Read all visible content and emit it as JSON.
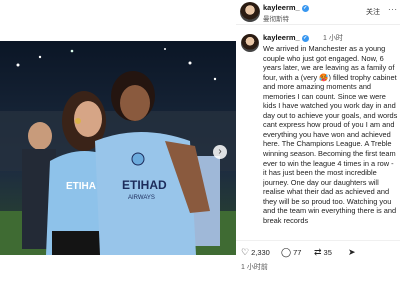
{
  "header": {
    "username": "kayleerm_",
    "subtitle": "曼彻斯特",
    "follow_label": "关注",
    "more_label": "···",
    "verified_icon": "verified-badge-icon"
  },
  "post": {
    "username": "kayleerm_",
    "time_ago": "1 小时",
    "caption": "We arrived in Manchester as a young couple who just got engaged. Now, 6 years later, we are leaving as a family of four, with a (very 🥵) filled trophy cabinet and more amazing moments and memories I can count. Since we were kids I have watched you work day in and day out to achieve your goals, and words cant express how proud of you I am and everything you have won and achieved here. The Champions League. A Treble winning season. Becoming the first team ever to win the league 4 times in a row - it has just been the most incredible journey. One day our daughters will realise what their dad as achieved and they will be so proud too. Watching you and the team win everything there is and break records"
  },
  "actions": {
    "likes": "2,330",
    "comments": "77",
    "reposts": "35"
  },
  "footer": {
    "time": "1 小时前"
  },
  "photo": {
    "jersey_sponsor": "ETIHAD",
    "jersey_sub": "AIRWAYS",
    "jersey_sponsor_left": "ETIHA",
    "next_arrow": "›"
  }
}
